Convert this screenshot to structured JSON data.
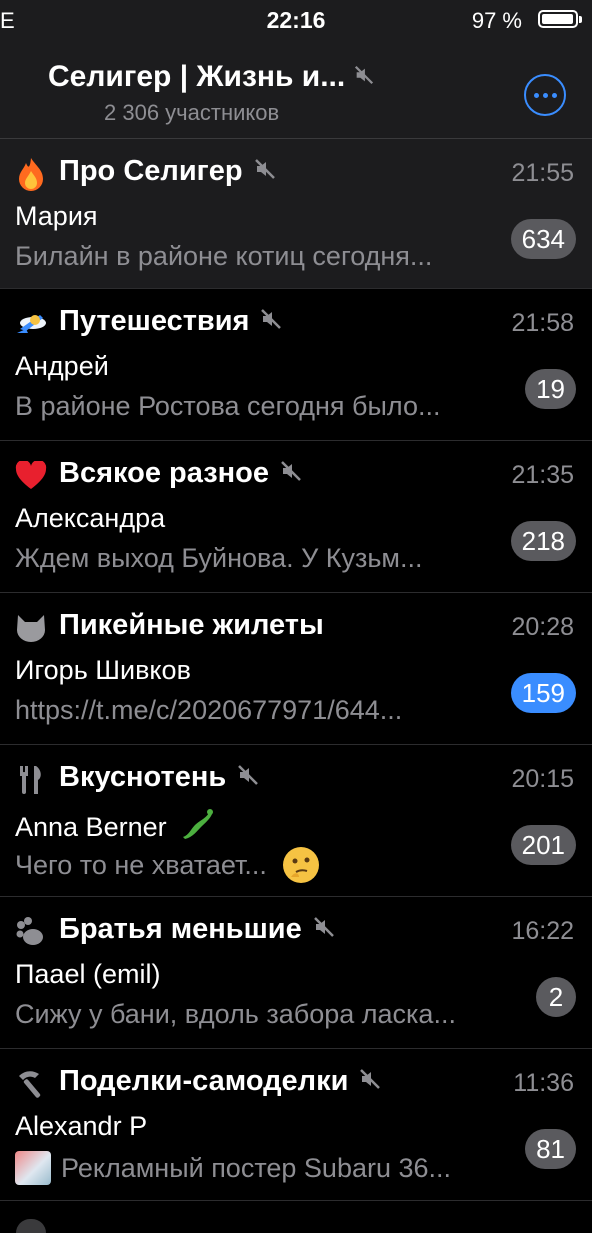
{
  "status_bar": {
    "network": "E",
    "time": "22:16",
    "battery_pct": "97 %",
    "battery_level": 0.97
  },
  "header": {
    "title": "Селигер | Жизнь и...",
    "subtitle": "2 306 участников",
    "muted": true
  },
  "colors": {
    "accent": "#3a8dff",
    "background": "#000000",
    "secondary_text": "#8e8e93",
    "badge_muted": "#5a5a5e"
  },
  "chats": [
    {
      "icon": "fire-icon",
      "title": "Про Селигер",
      "muted": true,
      "time": "21:55",
      "sender": "Мария",
      "message": "Билайн в районе котиц сегодня...",
      "badge": "634",
      "badge_muted": true
    },
    {
      "icon": "airplane-icon",
      "title": "Путешествия",
      "muted": true,
      "time": "21:58",
      "sender": "Андрей",
      "message": "В районе Ростова сегодня было...",
      "badge": "19",
      "badge_muted": true
    },
    {
      "icon": "heart-icon",
      "title": "Всякое разное",
      "muted": true,
      "time": "21:35",
      "sender": "Александра",
      "message": "Ждем выход Буйнова. У Кузьм...",
      "badge": "218",
      "badge_muted": true
    },
    {
      "icon": "cat-icon",
      "title": "Пикейные жилеты",
      "muted": false,
      "time": "20:28",
      "sender": "Игорь Шивков",
      "message": "https://t.me/c/2020677971/644...",
      "badge": "159",
      "badge_muted": false
    },
    {
      "icon": "cutlery-icon",
      "title": "Вкуснотень",
      "muted": true,
      "time": "20:15",
      "sender": "Anna Berner",
      "message": "Чего то не хватает...",
      "badge": "201",
      "badge_muted": true
    },
    {
      "icon": "paw-icon",
      "title": "Братья меньшие",
      "muted": true,
      "time": "16:22",
      "sender": "Паael (emil)",
      "message": "Сижу у бани, вдоль забора ласка...",
      "badge": "2",
      "badge_muted": true
    },
    {
      "icon": "hammer-icon",
      "title": "Поделки-самоделки",
      "muted": true,
      "time": "11:36",
      "sender": "Alexandr P",
      "message": "Рекламный постер Subaru 36...",
      "badge": "81",
      "badge_muted": true
    }
  ]
}
